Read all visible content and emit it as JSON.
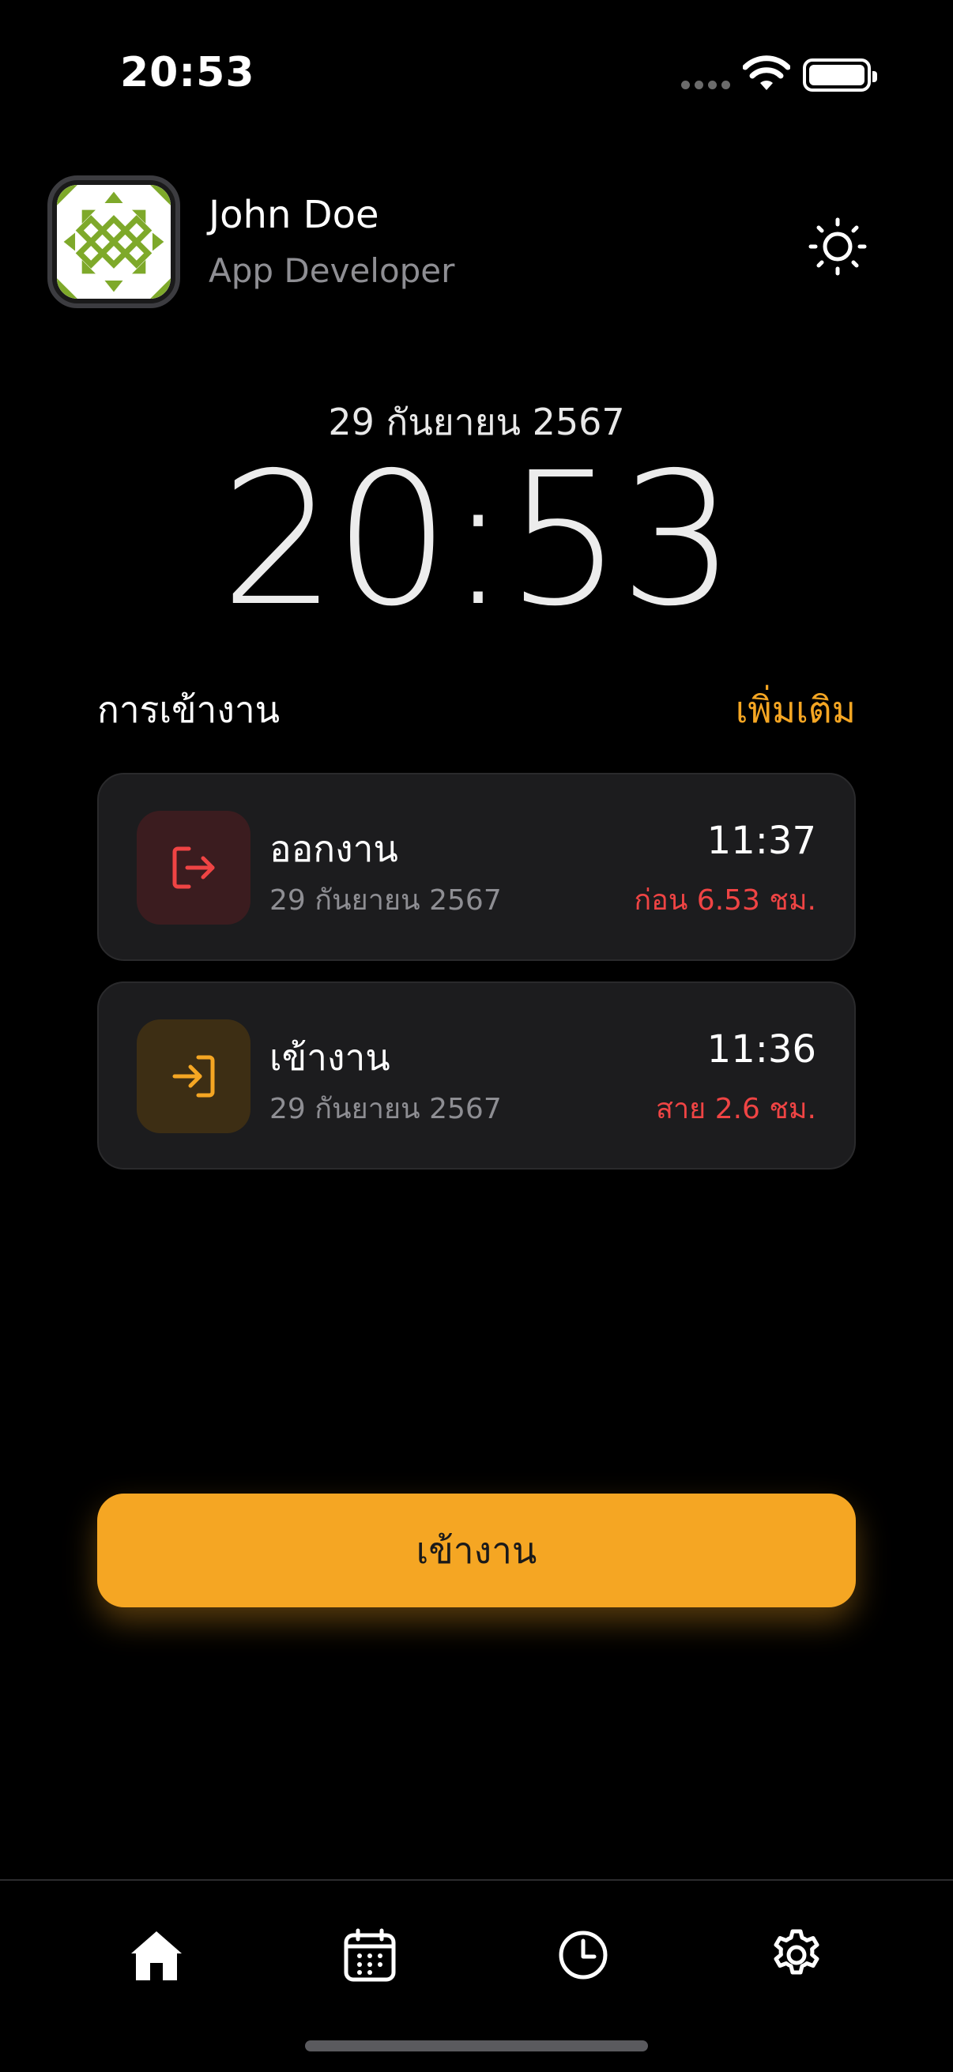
{
  "status_bar": {
    "time": "20:53"
  },
  "profile": {
    "name": "John Doe",
    "role": "App Developer",
    "theme_icon": "sun-icon"
  },
  "clock": {
    "date": "29 กันยายน 2567",
    "time": "20:53"
  },
  "attendance": {
    "title": "การเข้างาน",
    "more_label": "เพิ่มเติม",
    "records": [
      {
        "icon": "logout-icon",
        "title": "ออกงาน",
        "date": "29 กันยายน 2567",
        "time": "11:37",
        "note": "ก่อน 6.53 ชม.",
        "icon_color": "#ef4444",
        "icon_bg": "#3b1c1f"
      },
      {
        "icon": "login-icon",
        "title": "เข้างาน",
        "date": "29 กันยายน 2567",
        "time": "11:36",
        "note": "สาย 2.6 ชม.",
        "icon_color": "#f5a623",
        "icon_bg": "#3d2e14"
      }
    ]
  },
  "primary_action": {
    "label": "เข้างาน",
    "color": "#f5a623"
  },
  "tabbar": {
    "items": [
      {
        "icon": "home-icon",
        "active": true
      },
      {
        "icon": "calendar-icon",
        "active": false
      },
      {
        "icon": "clock-icon",
        "active": false
      },
      {
        "icon": "gear-icon",
        "active": false
      }
    ]
  }
}
